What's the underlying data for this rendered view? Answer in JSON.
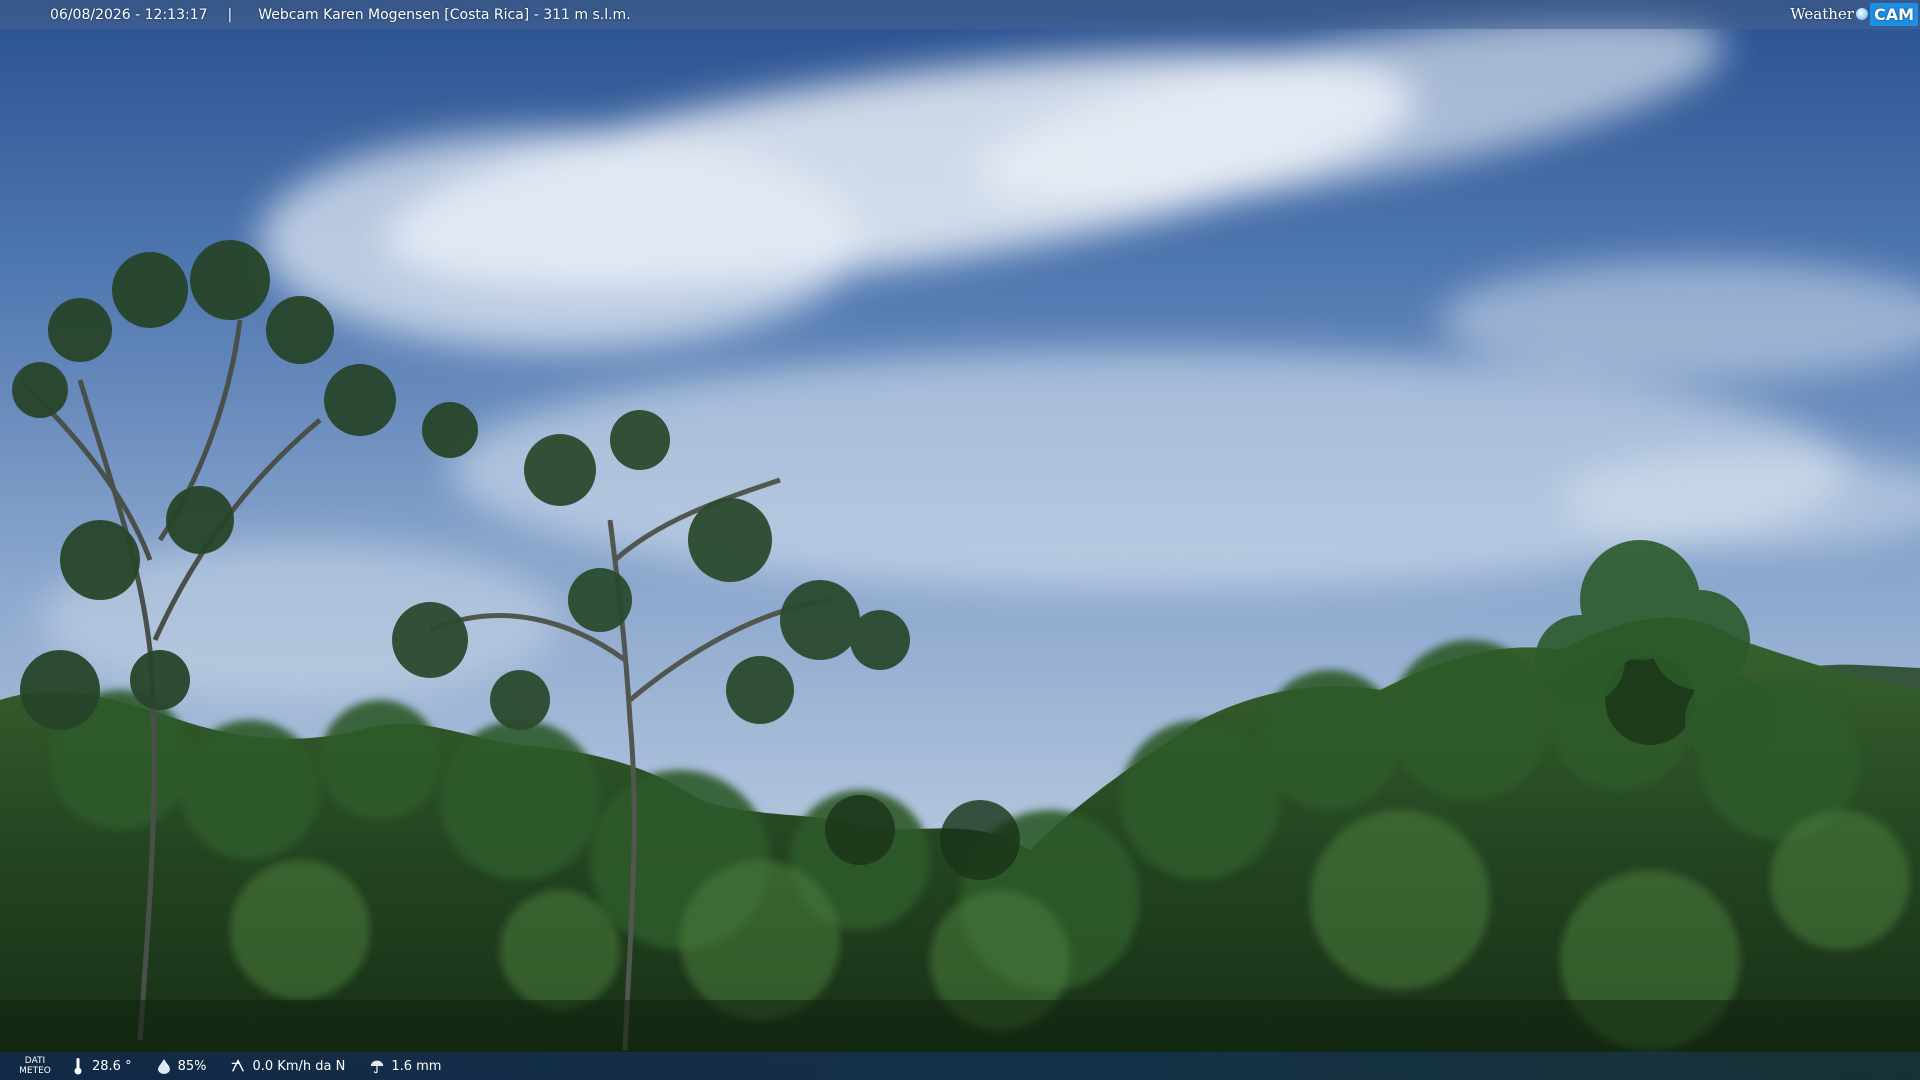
{
  "header": {
    "datetime": "06/08/2026 - 12:13:17",
    "separator": "|",
    "caption": "Webcam Karen Mogensen [Costa Rica]  - 311 m s.l.m.",
    "brand_word": "Weather",
    "brand_cam": "CAM"
  },
  "footer": {
    "dati_label_line1": "DATI",
    "dati_label_line2": "METEO",
    "items": [
      {
        "icon": "thermometer-icon",
        "value": "28.6 °"
      },
      {
        "icon": "humidity-drop-icon",
        "value": "85%"
      },
      {
        "icon": "wind-icon",
        "value": "0.0 Km/h da N"
      },
      {
        "icon": "rain-icon",
        "value": "1.6 mm"
      }
    ]
  },
  "colors": {
    "sky_top": "#2c5595",
    "sky_mid": "#6f92bf",
    "sky_low": "#a8bfd8",
    "foliage_dark": "#1f3a1e",
    "foliage_mid": "#3d6a33",
    "brand_blue": "#1e8fe6"
  }
}
